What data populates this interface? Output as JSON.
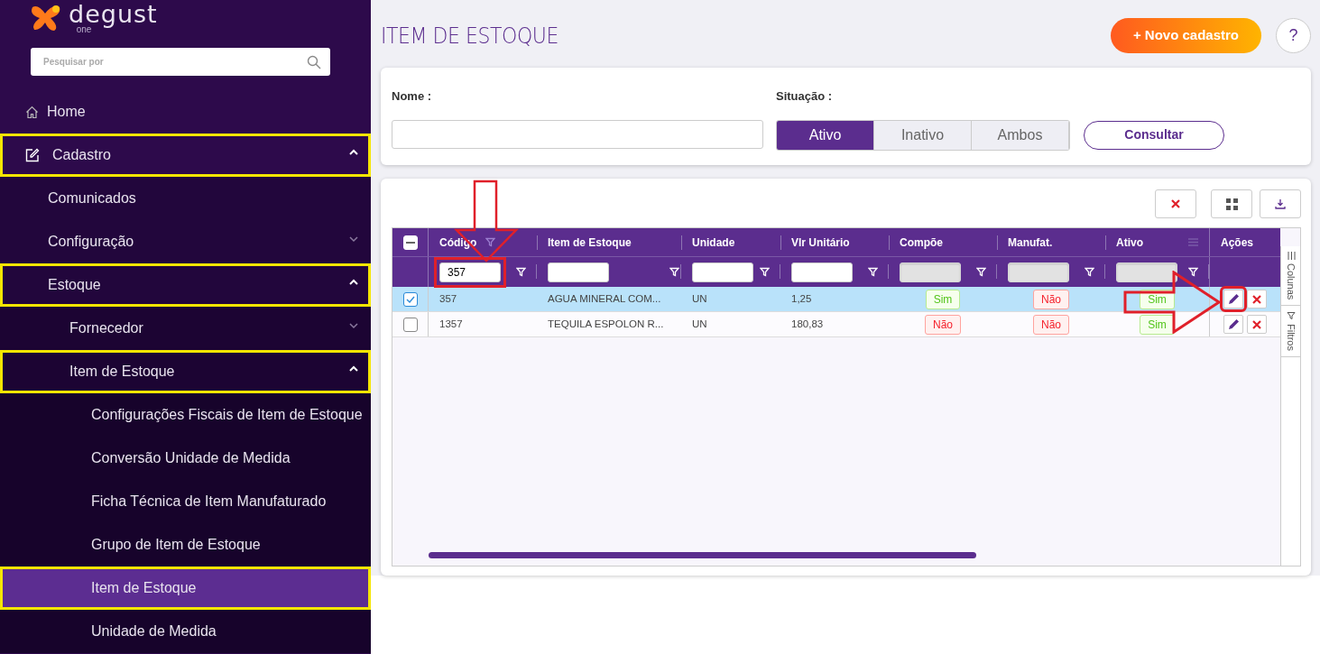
{
  "logo": {
    "name": "degust",
    "sub": "one"
  },
  "sidebar": {
    "search": {
      "placeholder": "Pesquisar por"
    },
    "items": [
      {
        "label": "Home",
        "highlighted": false,
        "selected": false
      },
      {
        "label": "Cadastro",
        "highlighted": true,
        "selected": false,
        "expanded": true,
        "children": [
          {
            "label": "Comunicados",
            "highlighted": false,
            "selected": false
          },
          {
            "label": "Configuração",
            "highlighted": false,
            "selected": false,
            "expanded": false
          },
          {
            "label": "Estoque",
            "highlighted": true,
            "selected": false,
            "expanded": true,
            "children": [
              {
                "label": "Fornecedor",
                "highlighted": false,
                "selected": false,
                "expanded": false
              },
              {
                "label": "Item de Estoque",
                "highlighted": true,
                "selected": false,
                "expanded": true,
                "children": [
                  {
                    "label": "Configurações Fiscais de Item de Estoque",
                    "highlighted": false,
                    "selected": false
                  },
                  {
                    "label": "Conversão Unidade de Medida",
                    "highlighted": false,
                    "selected": false
                  },
                  {
                    "label": "Ficha Técnica de Item Manufaturado",
                    "highlighted": false,
                    "selected": false
                  },
                  {
                    "label": "Grupo de Item de Estoque",
                    "highlighted": false,
                    "selected": false
                  },
                  {
                    "label": "Item de Estoque",
                    "highlighted": true,
                    "selected": true
                  },
                  {
                    "label": "Unidade de Medida",
                    "highlighted": false,
                    "selected": false
                  }
                ]
              }
            ]
          }
        ]
      }
    ]
  },
  "page_title": "ITEM DE ESTOQUE",
  "new_button": "+ Novo cadastro",
  "help_button": "?",
  "filters": {
    "name_label": "Nome :",
    "situation_label": "Situação :",
    "situation_options": [
      {
        "label": "Ativo",
        "selected": true
      },
      {
        "label": "Inativo",
        "selected": false
      },
      {
        "label": "Ambos",
        "selected": false
      }
    ],
    "search_button": "Consultar"
  },
  "table": {
    "select_all_partial": true,
    "columns": [
      {
        "label": "Código",
        "filtered": true
      },
      {
        "label": "Item de Estoque"
      },
      {
        "label": "Unidade"
      },
      {
        "label": "Vlr Unitário"
      },
      {
        "label": "Compõe"
      },
      {
        "label": "Manufat."
      },
      {
        "label": "Ativo",
        "menu": true
      }
    ],
    "actions_label": "Ações",
    "filter_row": [
      {
        "value": "357",
        "highlighted": true,
        "disabled": false
      },
      {
        "disabled": false
      },
      {
        "disabled": false
      },
      {
        "disabled": false
      },
      {
        "disabled": true
      },
      {
        "disabled": true
      },
      {
        "disabled": true
      }
    ],
    "rows": [
      {
        "selected": true,
        "edit_highlighted": true,
        "cells": [
          {
            "kind": "text",
            "text": "357"
          },
          {
            "kind": "text",
            "text": "AGUA MINERAL COM..."
          },
          {
            "kind": "text",
            "text": "UN"
          },
          {
            "kind": "text",
            "text": "1,25"
          },
          {
            "kind": "yes",
            "text": "Sim"
          },
          {
            "kind": "no",
            "text": "Não"
          },
          {
            "kind": "yes",
            "text": "Sim"
          }
        ]
      },
      {
        "selected": false,
        "edit_highlighted": false,
        "cells": [
          {
            "kind": "text",
            "text": "1357"
          },
          {
            "kind": "text",
            "text": "TEQUILA ESPOLON R..."
          },
          {
            "kind": "text",
            "text": "UN"
          },
          {
            "kind": "text",
            "text": "180,83"
          },
          {
            "kind": "no",
            "text": "Não"
          },
          {
            "kind": "no",
            "text": "Não"
          },
          {
            "kind": "yes",
            "text": "Sim"
          }
        ]
      }
    ],
    "side_panel": [
      "Colunas",
      "Filtros"
    ]
  }
}
